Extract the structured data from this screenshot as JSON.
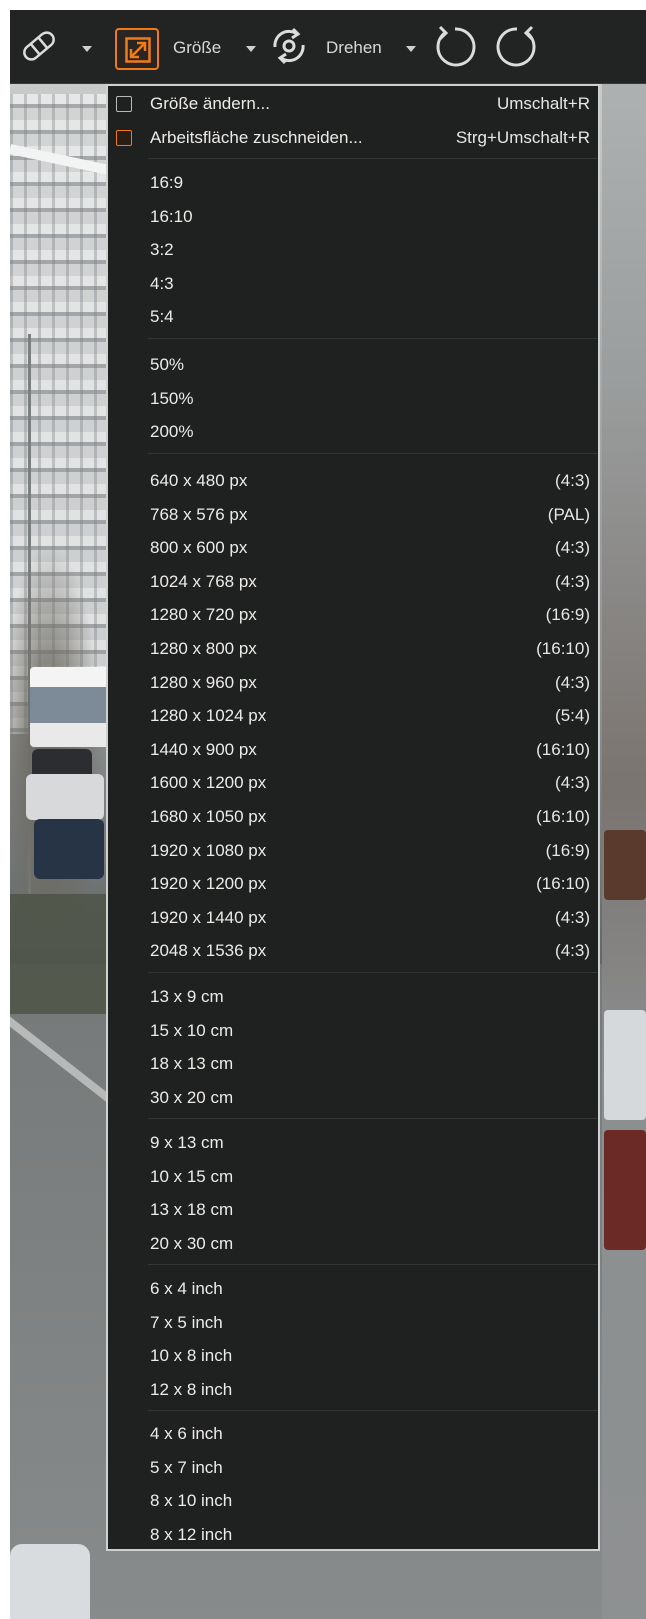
{
  "toolbar": {
    "size_label": "Größe",
    "rotate_label": "Drehen",
    "accent": "#f07c19",
    "icons": [
      "bandage-icon",
      "chevron-down-icon",
      "resize-icon",
      "rotate-object-icon",
      "rotate-left-icon",
      "rotate-right-icon"
    ]
  },
  "menu": {
    "top_items": [
      {
        "label": "Größe ändern...",
        "shortcut": "Umschalt+R",
        "icon": "resize-icon"
      },
      {
        "label": "Arbeitsfläche zuschneiden...",
        "shortcut": "Strg+Umschalt+R",
        "icon": "crop-canvas-icon"
      }
    ],
    "ratios": [
      "16:9",
      "16:10",
      "3:2",
      "4:3",
      "5:4"
    ],
    "percents": [
      "50%",
      "150%",
      "200%"
    ],
    "pixels": [
      {
        "label": "640 x 480 px",
        "tag": "(4:3)"
      },
      {
        "label": "768 x 576 px",
        "tag": "(PAL)"
      },
      {
        "label": "800 x 600 px",
        "tag": "(4:3)"
      },
      {
        "label": "1024 x 768 px",
        "tag": "(4:3)"
      },
      {
        "label": "1280 x 720 px",
        "tag": "(16:9)"
      },
      {
        "label": "1280 x 800 px",
        "tag": "(16:10)"
      },
      {
        "label": "1280 x 960 px",
        "tag": "(4:3)"
      },
      {
        "label": "1280 x 1024 px",
        "tag": "(5:4)"
      },
      {
        "label": "1440 x 900 px",
        "tag": "(16:10)"
      },
      {
        "label": "1600 x 1200 px",
        "tag": "(4:3)"
      },
      {
        "label": "1680 x 1050 px",
        "tag": "(16:10)"
      },
      {
        "label": "1920 x 1080 px",
        "tag": "(16:9)"
      },
      {
        "label": "1920 x 1200 px",
        "tag": "(16:10)"
      },
      {
        "label": "1920 x 1440 px",
        "tag": "(4:3)"
      },
      {
        "label": "2048 x 1536 px",
        "tag": "(4:3)"
      }
    ],
    "cm_landscape": [
      "13 x 9 cm",
      "15 x 10 cm",
      "18 x 13 cm",
      "30 x 20 cm"
    ],
    "cm_portrait": [
      "9 x 13 cm",
      "10 x 15 cm",
      "13 x 18 cm",
      "20 x 30 cm"
    ],
    "inch_landscape": [
      "6 x 4 inch",
      "7 x 5 inch",
      "10 x 8 inch",
      "12 x 8 inch"
    ],
    "inch_portrait": [
      "4 x 6 inch",
      "5 x 7 inch",
      "8 x 10 inch",
      "8 x 12 inch"
    ]
  }
}
